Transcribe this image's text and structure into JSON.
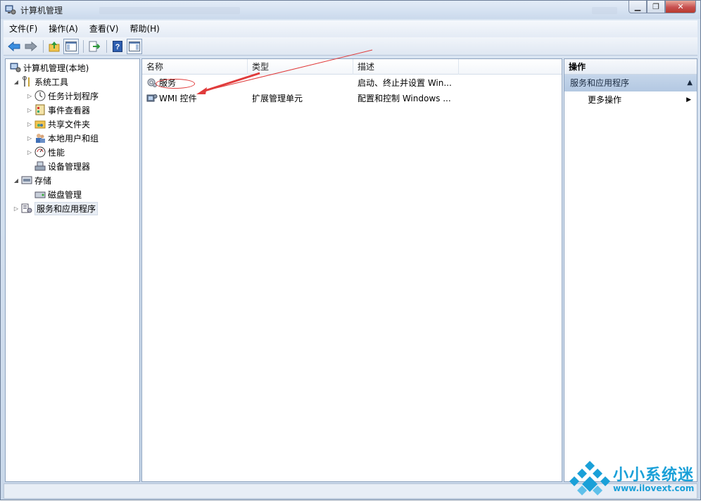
{
  "window": {
    "title": "计算机管理",
    "minimize_glyph": "▁",
    "restore_glyph": "❐",
    "close_glyph": "✕"
  },
  "menu": [
    "文件(F)",
    "操作(A)",
    "查看(V)",
    "帮助(H)"
  ],
  "toolbar": {
    "icons": [
      "back-arrow-icon",
      "forward-arrow-icon",
      "up-folder-icon",
      "show-hide-tree-icon",
      "export-list-icon",
      "help-icon",
      "show-hide-action-pane-icon"
    ]
  },
  "tree": {
    "root": "计算机管理(本地)",
    "items": [
      {
        "label": "系统工具",
        "arrow": "◢",
        "icon": "tools-icon"
      },
      {
        "label": "任务计划程序",
        "arrow": "▷",
        "icon": "clock-icon"
      },
      {
        "label": "事件查看器",
        "arrow": "▷",
        "icon": "event-viewer-icon"
      },
      {
        "label": "共享文件夹",
        "arrow": "▷",
        "icon": "shared-folder-icon"
      },
      {
        "label": "本地用户和组",
        "arrow": "▷",
        "icon": "users-icon"
      },
      {
        "label": "性能",
        "arrow": "▷",
        "icon": "performance-icon"
      },
      {
        "label": "设备管理器",
        "arrow": "",
        "icon": "device-manager-icon"
      },
      {
        "label": "存储",
        "arrow": "◢",
        "icon": "storage-icon"
      },
      {
        "label": "磁盘管理",
        "arrow": "",
        "icon": "disk-icon"
      },
      {
        "label": "服务和应用程序",
        "arrow": "▷",
        "icon": "services-apps-icon"
      }
    ]
  },
  "list": {
    "columns": [
      "名称",
      "类型",
      "描述"
    ],
    "rows": [
      {
        "name": "服务",
        "type": "",
        "desc": "启动、终止并设置 Win...",
        "icon": "services-gear-icon"
      },
      {
        "name": "WMI 控件",
        "type": "扩展管理单元",
        "desc": "配置和控制 Windows ...",
        "icon": "wmi-icon"
      }
    ]
  },
  "actions": {
    "header": "操作",
    "group": "服务和应用程序",
    "group_caret": "▲",
    "item": "更多操作",
    "item_arrow": "▶"
  },
  "watermark": {
    "title": "小小系统迷",
    "url": "www.ilovext.com"
  },
  "colors": {
    "accent": "#1aa0d8",
    "annotation": "#e03b3b"
  }
}
